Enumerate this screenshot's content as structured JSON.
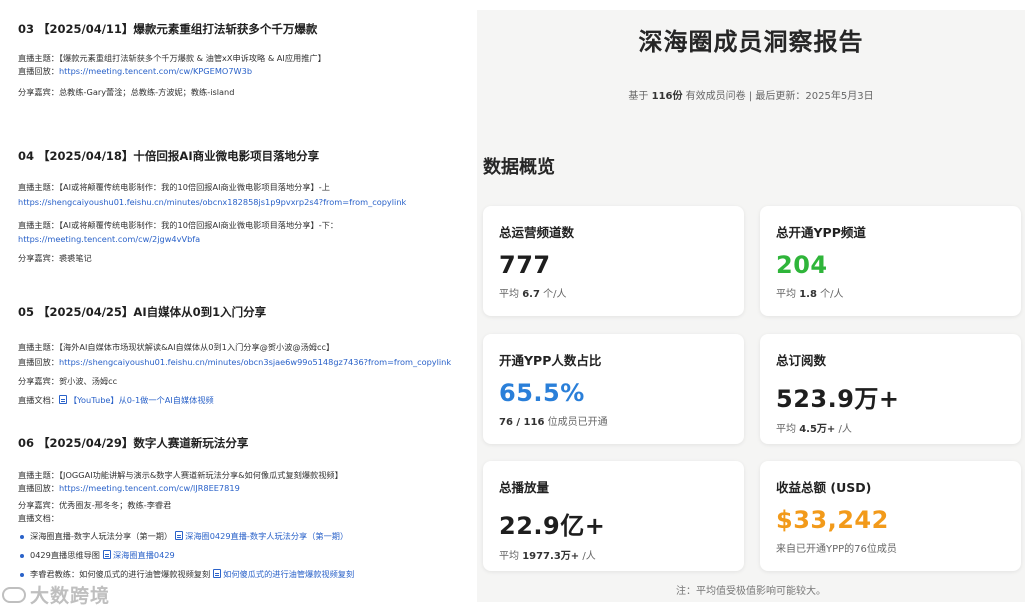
{
  "left": {
    "sessions": [
      {
        "title": "03 【2025/04/11】爆款元素重组打法斩获多个千万爆款",
        "topic_label": "直播主题：",
        "topic": "【爆款元素重组打法斩获多个千万爆款 & 油管xX申诉攻略 & AI应用推广】",
        "replay_label": "直播回放：",
        "replay_link": "https://meeting.tencent.com/cw/KPGEMO7W3b",
        "guests_label": "分享嘉宾：",
        "guests": "总教练-Gary蕾淦；总教练-方波妮；教练-island"
      },
      {
        "title": "04 【2025/04/18】十倍回报AI商业微电影项目落地分享",
        "topic_label": "直播主题：",
        "topic1": "【AI或将颠覆传统电影制作：我的10倍回报AI商业微电影项目落地分享】-上",
        "link1": "https://shengcaiyoushu01.feishu.cn/minutes/obcnx182858js1p9pvxrp2s4?from=from_copylink",
        "topic2": "【AI或将颠覆传统电影制作：我的10倍回报AI商业微电影项目落地分享】-下：",
        "link2": "https://meeting.tencent.com/cw/2jgw4vVbfa",
        "guests_label": "分享嘉宾：",
        "guests": "裘裘笔记"
      },
      {
        "title": "05 【2025/04/25】AI自媒体从0到1入门分享",
        "topic_label": "直播主题：",
        "topic": "【海外AI自媒体市场现状解读&AI自媒体从0到1入门分享@贺小波@汤姆cc】",
        "replay_label": "直播回放：",
        "replay_link": "https://shengcaiyoushu01.feishu.cn/minutes/obcn3sjae6w99o5148gz7436?from=from_copylink",
        "guests_label": "分享嘉宾：",
        "guests": "贺小波、汤姆cc",
        "docs_label": "直播文档：",
        "doc": "【YouTube】从0-1做一个AI自媒体视频"
      },
      {
        "title": "06 【2025/04/29】数字人赛道新玩法分享",
        "topic_label": "直播主题：",
        "topic": "【JOGGAI功能讲解与演示&数字人赛道新玩法分享&如何像瓜式复刻爆款视频】",
        "replay_label": "直播回放：",
        "replay_link": "https://meeting.tencent.com/cw/lJR8EE7819",
        "guests_label": "分享嘉宾：",
        "guests": "优秀圈友-邢冬冬；教练-李睿君",
        "docs_label": "直播文档：",
        "bullets": [
          {
            "text": "深海圈直播-数字人玩法分享（第一期）",
            "doc": "深海圈0429直播-数字人玩法分享（第一期）"
          },
          {
            "text": "0429直播思维导图",
            "doc": "深海圈直播0429"
          },
          {
            "text": "李睿君教练：如何傻瓜式的进行油管爆款视频复刻",
            "doc": "如何傻瓜式的进行油管爆款视频复刻"
          }
        ]
      }
    ],
    "watermark": "大数跨境"
  },
  "report": {
    "title": "深海圈成员洞察报告",
    "sub_prefix": "基于",
    "sub_count": "116份",
    "sub_suffix": "有效成员问卷 | 最后更新：2025年5月3日",
    "section": "数据概览",
    "cards": [
      {
        "label": "总运营频道数",
        "value": "777",
        "sub_pre": "平均",
        "sub_bold": "6.7",
        "sub_post": "个/人",
        "accent": "#1e1e1e"
      },
      {
        "label": "总开通YPP频道",
        "value": "204",
        "sub_pre": "平均",
        "sub_bold": "1.8",
        "sub_post": "个/人",
        "accent": "#2fb53a"
      },
      {
        "label": "开通YPP人数占比",
        "value": "65.5%",
        "sub_pre": "",
        "sub_bold": "76 / 116",
        "sub_post": "位成员已开通",
        "accent": "#2a7fd9"
      },
      {
        "label": "总订阅数",
        "value": "523.9万+",
        "sub_pre": "平均",
        "sub_bold": "4.5万+",
        "sub_post": "/人",
        "accent": "#1e1e1e"
      },
      {
        "label": "总播放量",
        "value": "22.9亿+",
        "sub_pre": "平均",
        "sub_bold": "1977.3万+",
        "sub_post": "/人",
        "accent": "#1e1e1e"
      },
      {
        "label": "收益总额 (USD)",
        "value": "$33,242",
        "sub_pre": "来自已开通YPP的76位成员",
        "sub_bold": "",
        "sub_post": "",
        "accent": "#f29a1a"
      }
    ],
    "note": "注：平均值受极值影响可能较大。"
  }
}
